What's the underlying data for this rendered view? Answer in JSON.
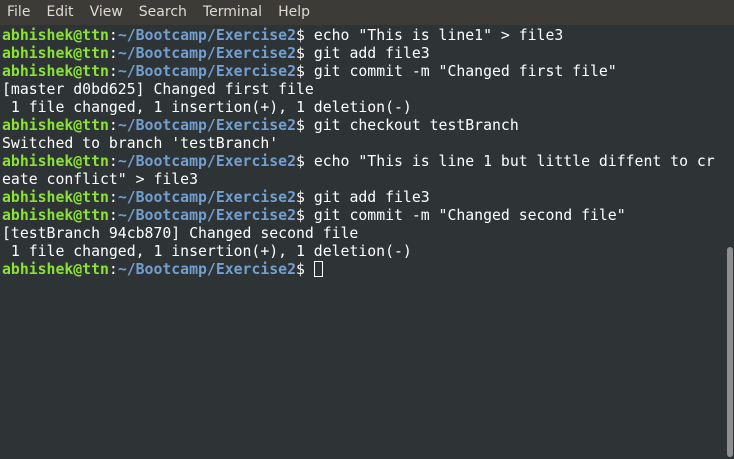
{
  "menu": [
    "File",
    "Edit",
    "View",
    "Search",
    "Terminal",
    "Help"
  ],
  "prompt": {
    "user": "abhishek@ttn",
    "colon": ":",
    "path": "~/Bootcamp/Exercise2",
    "symbol": "$"
  },
  "lines": [
    {
      "type": "cmd",
      "text": " echo \"This is line1\" > file3"
    },
    {
      "type": "cmd",
      "text": " git add file3"
    },
    {
      "type": "cmd",
      "text": " git commit -m \"Changed first file\""
    },
    {
      "type": "out",
      "text": "[master d0bd625] Changed first file"
    },
    {
      "type": "out",
      "text": " 1 file changed, 1 insertion(+), 1 deletion(-)"
    },
    {
      "type": "cmd",
      "text": " git checkout testBranch"
    },
    {
      "type": "out",
      "text": "Switched to branch 'testBranch'"
    },
    {
      "type": "cmd",
      "text": " echo \"This is line 1 but little diffent to cr"
    },
    {
      "type": "out",
      "text": "eate conflict\" > file3"
    },
    {
      "type": "cmd",
      "text": " git add file3"
    },
    {
      "type": "cmd",
      "text": " git commit -m \"Changed second file\""
    },
    {
      "type": "out",
      "text": "[testBranch 94cb870] Changed second file"
    },
    {
      "type": "out",
      "text": " 1 file changed, 1 insertion(+), 1 deletion(-)"
    },
    {
      "type": "cmd",
      "text": " "
    }
  ]
}
